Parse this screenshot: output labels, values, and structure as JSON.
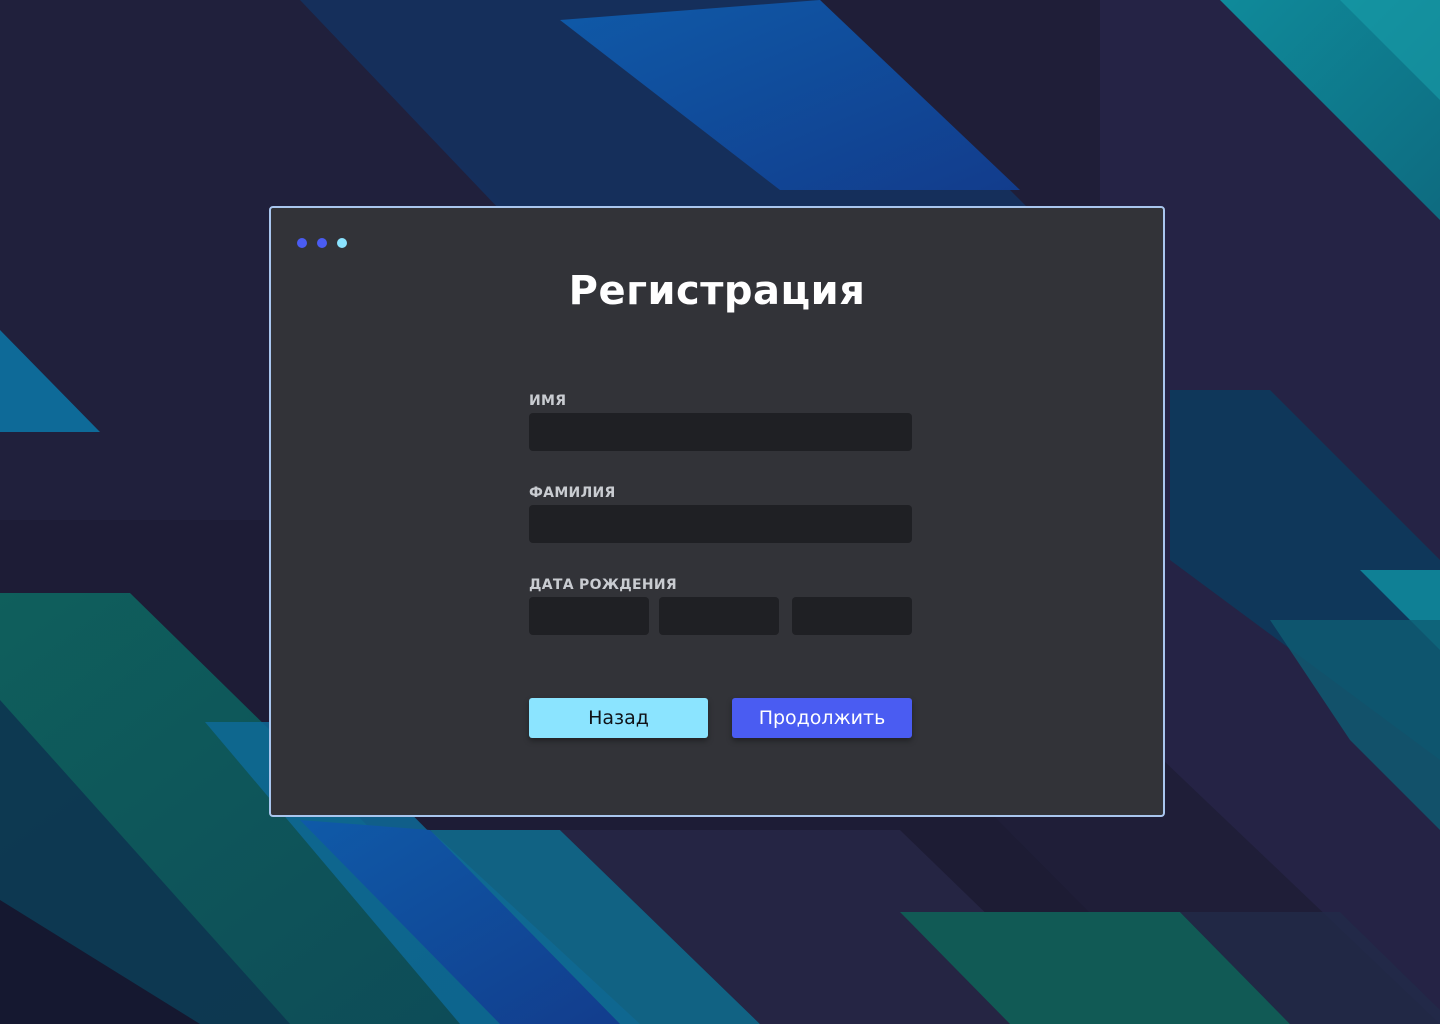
{
  "title": "Регистрация",
  "window_dots": [
    {
      "color": "#4a5cf2"
    },
    {
      "color": "#4a5cf2"
    },
    {
      "color": "#8be4ff"
    }
  ],
  "form": {
    "first_name": {
      "label": "ИМЯ",
      "value": ""
    },
    "last_name": {
      "label": "ФАМИЛИЯ",
      "value": ""
    },
    "birth_date": {
      "label": "ДАТА РОЖДЕНИЯ",
      "day": "",
      "month": "",
      "year": ""
    }
  },
  "buttons": {
    "back_label": "Назад",
    "continue_label": "Продолжить"
  },
  "colors": {
    "window_bg": "#323338",
    "window_border": "#a9c6ee",
    "input_bg": "#1f2024",
    "back_button": "#8be4ff",
    "continue_button": "#4a5cf2"
  }
}
